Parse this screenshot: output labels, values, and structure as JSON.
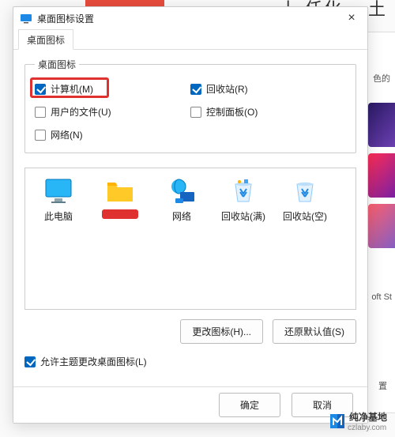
{
  "bg": {
    "righttext": "丨 任化 、土",
    "panel_text": "色的",
    "st": "oft St",
    "gear": "置"
  },
  "dialog": {
    "title": "桌面图标设置",
    "close": "×",
    "tab": "桌面图标",
    "group_legend": "桌面图标",
    "cb": {
      "computer": "计算机(M)",
      "recycle": "回收站(R)",
      "userfiles": "用户的文件(U)",
      "controlpanel": "控制面板(O)",
      "network": "网络(N)"
    },
    "icons": {
      "thispc": "此电脑",
      "userfolder": "",
      "network": "网络",
      "recycle_full": "回收站(满)",
      "recycle_empty": "回收站(空)"
    },
    "change_icon": "更改图标(H)...",
    "restore_default": "还原默认值(S)",
    "allow_theme": "允许主题更改桌面图标(L)",
    "ok": "确定",
    "cancel": "取消"
  },
  "watermark": {
    "name": "纯净基地",
    "url": "czlaby.com"
  }
}
